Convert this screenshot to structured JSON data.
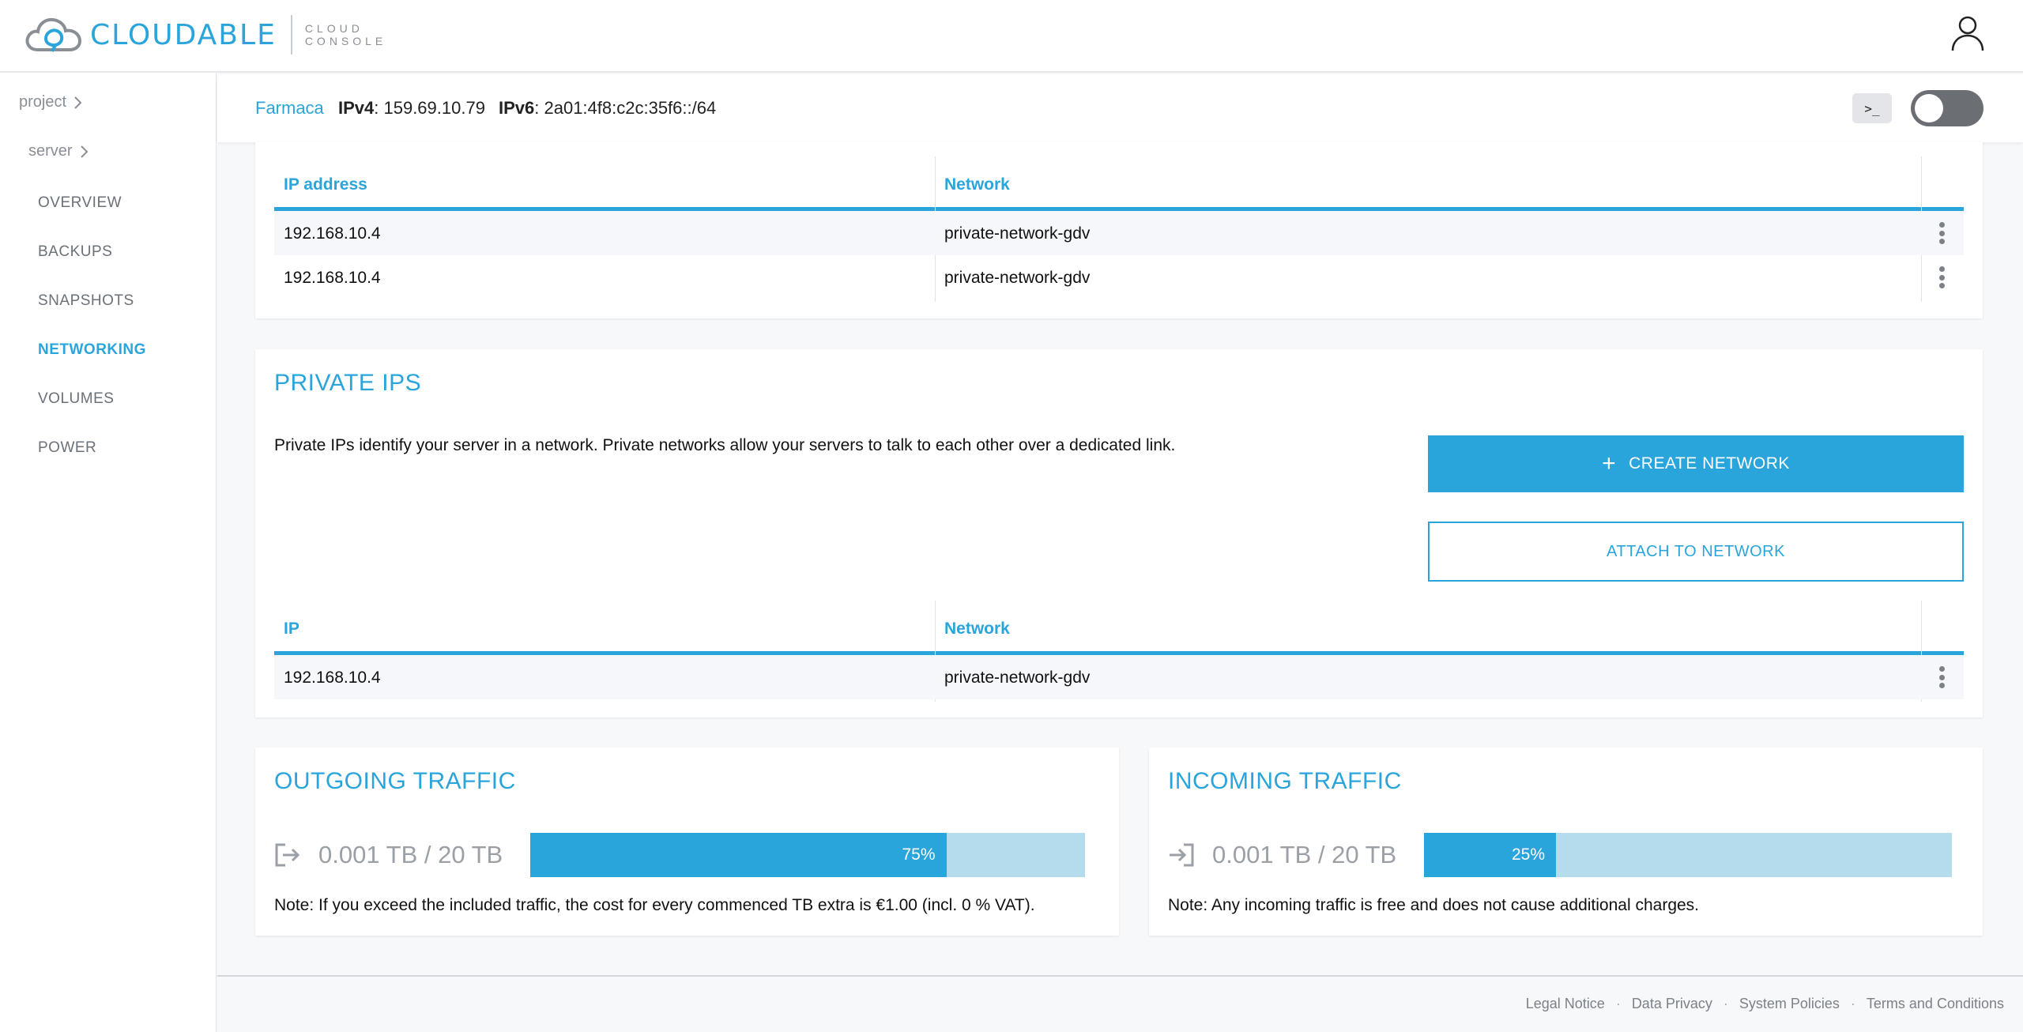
{
  "header": {
    "brand": "CLOUDABLE",
    "brand_sub_line1": "CLOUD",
    "brand_sub_line2": "CONSOLE",
    "logo_icon": "cloud-logo-icon",
    "user_icon": "user-icon"
  },
  "sidebar": {
    "breadcrumbs": [
      {
        "label": "project"
      },
      {
        "label": "server"
      }
    ],
    "items": [
      {
        "label": "OVERVIEW",
        "active": false
      },
      {
        "label": "BACKUPS",
        "active": false
      },
      {
        "label": "SNAPSHOTS",
        "active": false
      },
      {
        "label": "NETWORKING",
        "active": true
      },
      {
        "label": "VOLUMES",
        "active": false
      },
      {
        "label": "POWER",
        "active": false
      }
    ]
  },
  "server_bar": {
    "name": "Farmaca",
    "ipv4_label": "IPv4",
    "ipv4_value": ": 159.69.10.79",
    "ipv6_label": "IPv6",
    "ipv6_value": ": 2a01:4f8:c2c:35f6::/64",
    "terminal_label": ">_",
    "power_toggle_on": false
  },
  "top_table": {
    "columns": [
      "IP address",
      "Network"
    ],
    "rows": [
      {
        "ip": "192.168.10.4",
        "network": "private-network-gdv"
      },
      {
        "ip": "192.168.10.4",
        "network": "private-network-gdv"
      }
    ]
  },
  "private_ips": {
    "title": "PRIVATE IPS",
    "description": "Private IPs identify your server in a network. Private networks allow your servers to talk to each other over a dedicated link.",
    "create_button": "CREATE NETWORK",
    "create_icon": "+",
    "attach_button": "ATTACH TO NETWORK",
    "columns": [
      "IP",
      "Network"
    ],
    "rows": [
      {
        "ip": "192.168.10.4",
        "network": "private-network-gdv"
      }
    ]
  },
  "outgoing_traffic": {
    "title": "OUTGOING TRAFFIC",
    "usage": "0.001 TB / 20 TB",
    "percent": 75,
    "percent_label": "75%",
    "note": "Note: If you exceed the included traffic, the cost for every commenced TB extra is €1.00 (incl. 0 % VAT)."
  },
  "incoming_traffic": {
    "title": "INCOMING TRAFFIC",
    "usage": "0.001 TB / 20 TB",
    "percent": 25,
    "percent_label": "25%",
    "note": "Note: Any incoming traffic is free and does not cause additional charges."
  },
  "footer": {
    "links": [
      "Legal Notice",
      "Data Privacy",
      "System Policies",
      "Terms and Conditions"
    ],
    "separator": "·"
  },
  "colors": {
    "accent": "#2aa5dc",
    "bar_track": "#b5dcec",
    "toggle_off": "#6b6e72"
  }
}
